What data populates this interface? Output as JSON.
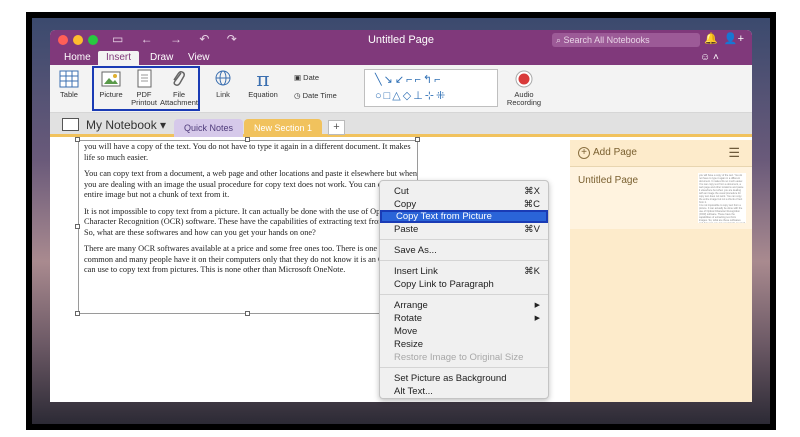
{
  "window": {
    "title": "Untitled Page"
  },
  "search": {
    "placeholder": "Search All Notebooks"
  },
  "tabs": [
    "Home",
    "Insert",
    "Draw",
    "View"
  ],
  "ribbon": {
    "table": "Table",
    "picture": "Picture",
    "pdf": "PDF Printout",
    "file": "File Attachment",
    "link": "Link",
    "equation": "Equation",
    "date": "Date",
    "date_time": "Date Time",
    "audio": "Audio Recording"
  },
  "notebook": {
    "name": "My Notebook"
  },
  "sections": [
    "Quick Notes",
    "New Section 1"
  ],
  "sidebar": {
    "add_page": "Add Page",
    "page_title": "Untitled Page"
  },
  "document": {
    "paragraphs": [
      "you will have a copy of the text. You do not have to type it again in a different document. It makes life so much easier.",
      "You can copy text from a document, a web page and other locations and paste it elsewhere but when you are dealing with an image the usual procedure for copy text does not work. You can copy the entire image but not a chunk of text from it.",
      "It is not impossible to copy text from a picture. It can actually be done with the use of Optical Character Recognition (OCR) software. These have the capabilities of extracting text from images. So, what are these softwares and how can you get your hands on one?",
      "There are many OCR softwares available at a price and some free ones too. There is one that is very common and many people have it on their computers only that they do not know it is an OCR they can use to copy text from pictures. This is none other than Microsoft OneNote."
    ]
  },
  "context_menu": {
    "items": [
      {
        "label": "Cut",
        "shortcut": "⌘X"
      },
      {
        "label": "Copy",
        "shortcut": "⌘C"
      },
      {
        "label": "Copy Text from Picture",
        "shortcut": ""
      },
      {
        "label": "Paste",
        "shortcut": "⌘V"
      },
      {
        "label": "Save As...",
        "shortcut": ""
      },
      {
        "label": "Insert Link",
        "shortcut": "⌘K"
      },
      {
        "label": "Copy Link to Paragraph",
        "shortcut": ""
      },
      {
        "label": "Arrange",
        "shortcut": ""
      },
      {
        "label": "Rotate",
        "shortcut": ""
      },
      {
        "label": "Move",
        "shortcut": ""
      },
      {
        "label": "Resize",
        "shortcut": ""
      },
      {
        "label": "Restore Image to Original Size",
        "shortcut": ""
      },
      {
        "label": "Set Picture as Background",
        "shortcut": ""
      },
      {
        "label": "Alt Text...",
        "shortcut": ""
      }
    ]
  },
  "colors": {
    "accent": "#80397b",
    "highlight": "#2a64d8",
    "section_active": "#f1c25d"
  }
}
